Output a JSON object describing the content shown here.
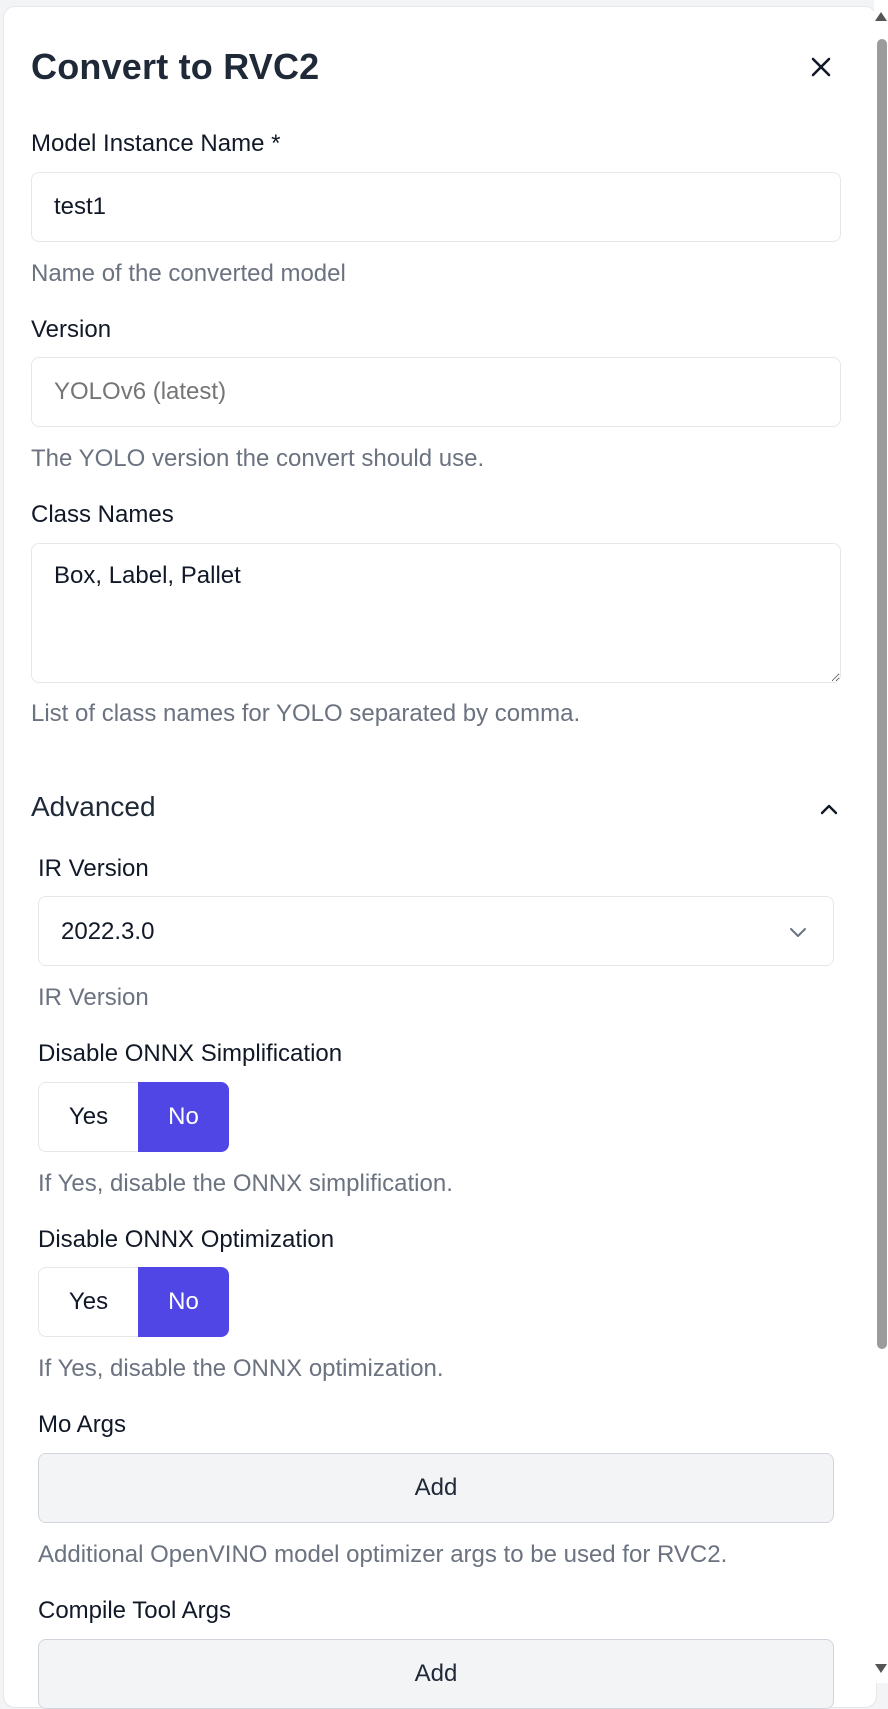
{
  "dialog": {
    "title": "Convert to RVC2"
  },
  "fields": {
    "model_instance_name": {
      "label": "Model Instance Name *",
      "value": "test1",
      "help": "Name of the converted model"
    },
    "version": {
      "label": "Version",
      "placeholder": "YOLOv6 (latest)",
      "help": "The YOLO version the convert should use."
    },
    "class_names": {
      "label": "Class Names",
      "value": "Box, Label, Pallet",
      "help": "List of class names for YOLO separated by comma."
    }
  },
  "advanced": {
    "title": "Advanced",
    "ir_version": {
      "label": "IR Version",
      "value": "2022.3.0",
      "help": "IR Version"
    },
    "disable_onnx_simplification": {
      "label": "Disable ONNX Simplification",
      "yes": "Yes",
      "no": "No",
      "selected": "No",
      "help": "If Yes, disable the ONNX simplification."
    },
    "disable_onnx_optimization": {
      "label": "Disable ONNX Optimization",
      "yes": "Yes",
      "no": "No",
      "selected": "No",
      "help": "If Yes, disable the ONNX optimization."
    },
    "mo_args": {
      "label": "Mo Args",
      "button": "Add",
      "help": "Additional OpenVINO model optimizer args to be used for RVC2."
    },
    "compile_tool_args": {
      "label": "Compile Tool Args",
      "button": "Add"
    }
  },
  "colors": {
    "accent": "#4f46e5",
    "help_text": "#6b7280",
    "border": "#e5e7eb"
  },
  "icons": {
    "close": "close-icon",
    "collapse": "chevron-up-icon",
    "select": "chevron-down-icon"
  }
}
